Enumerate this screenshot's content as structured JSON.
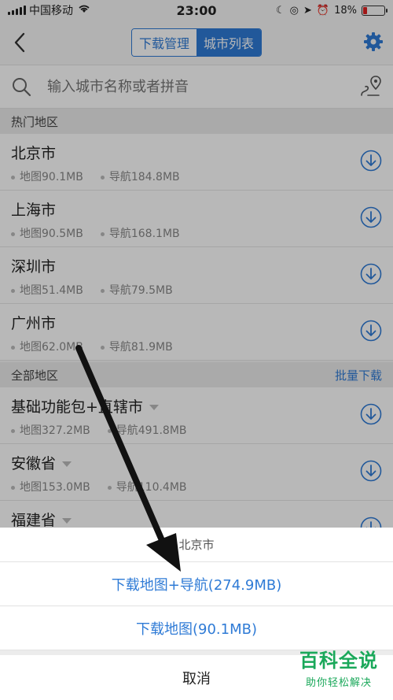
{
  "status": {
    "carrier": "中国移动",
    "time": "23:00",
    "battery": "18%",
    "battery_level": 0.18
  },
  "nav": {
    "tab_download": "下载管理",
    "tab_city_list": "城市列表"
  },
  "search": {
    "placeholder": "输入城市名称或者拼音"
  },
  "hot_section": {
    "title": "热门地区",
    "cities": [
      {
        "name": "北京市",
        "map": "地图90.1MB",
        "nav": "导航184.8MB"
      },
      {
        "name": "上海市",
        "map": "地图90.5MB",
        "nav": "导航168.1MB"
      },
      {
        "name": "深圳市",
        "map": "地图51.4MB",
        "nav": "导航79.5MB"
      },
      {
        "name": "广州市",
        "map": "地图62.0MB",
        "nav": "导航81.9MB"
      }
    ]
  },
  "all_section": {
    "title": "全部地区",
    "action": "批量下载",
    "cities": [
      {
        "name": "基础功能包+直辖市",
        "map": "地图327.2MB",
        "nav": "导航491.8MB"
      },
      {
        "name": "安徽省",
        "map": "地图153.0MB",
        "nav": "导航110.4MB"
      },
      {
        "name": "福建省",
        "map": "",
        "nav": ""
      }
    ]
  },
  "sheet": {
    "title": "北京市",
    "option_map_nav": "下载地图+导航(274.9MB)",
    "option_map": "下载地图(90.1MB)",
    "cancel": "取消"
  },
  "watermark": {
    "main": "百科全说",
    "sub": "助你轻松解决"
  },
  "colors": {
    "accent": "#2f7bd6",
    "watermark": "#1aa85a",
    "battery_low": "#e02020"
  }
}
